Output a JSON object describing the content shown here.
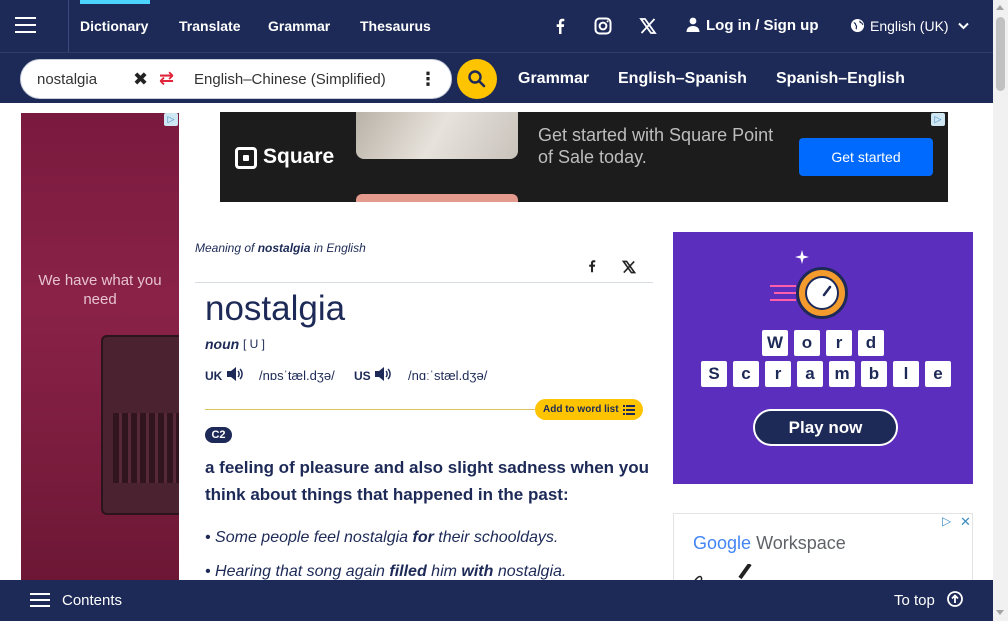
{
  "nav": {
    "tabs": [
      "Dictionary",
      "Translate",
      "Grammar",
      "Thesaurus"
    ],
    "login": "Log in / Sign up",
    "language": "English (UK)"
  },
  "search": {
    "query": "nostalgia",
    "dictionary": "English–Chinese (Simplified)",
    "quicklinks": [
      "Grammar",
      "English–Spanish",
      "Spanish–English"
    ]
  },
  "ads": {
    "left_text": "We have what you need",
    "square_logo": "Square",
    "square_tagline": "Get started with Square Point of Sale today.",
    "square_cta": "Get started",
    "scramble_row1": [
      "W",
      "o",
      "r",
      "d"
    ],
    "scramble_row2": [
      "S",
      "c",
      "r",
      "a",
      "m",
      "b",
      "l",
      "e"
    ],
    "scramble_cta": "Play now",
    "workspace_google": "Google",
    "workspace_name": "Workspace"
  },
  "entry": {
    "meaning_prefix": "Meaning of ",
    "meaning_word": "nostalgia",
    "meaning_suffix": " in English",
    "headword": "nostalgia",
    "pos": "noun",
    "grammar": "[ U ]",
    "uk_label": "UK",
    "uk_ipa": "/nɒsˈtæl.dʒə/",
    "us_label": "US",
    "us_ipa": "/nɑːˈstæl.dʒə/",
    "add_to_word_list": "Add to word list",
    "level": "C2",
    "definition": "a feeling of pleasure and also slight sadness when you think about things that happened in the past:",
    "examples": [
      {
        "parts": [
          "Some people feel nostalgia ",
          "for",
          " their schooldays."
        ]
      },
      {
        "parts": [
          "Hearing that song again ",
          "filled",
          " him ",
          "with",
          " nostalgia."
        ]
      }
    ]
  },
  "bottom": {
    "contents": "Contents",
    "to_top": "To top"
  },
  "colors": {
    "navy": "#1d2a57",
    "accent_yellow": "#fec400",
    "accent_cyan": "#4ad4ff",
    "ad_purple": "#5b2ebd",
    "square_blue": "#006aff"
  }
}
